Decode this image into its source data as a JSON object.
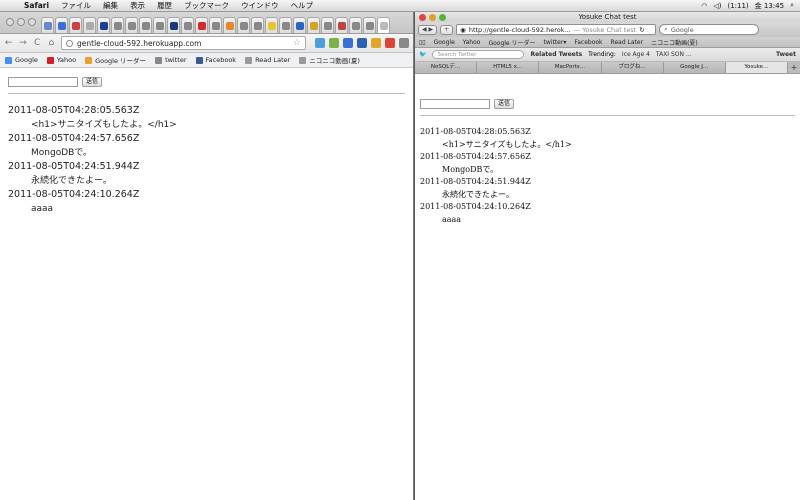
{
  "menubar": {
    "app": "Safari",
    "items": [
      "ファイル",
      "編集",
      "表示",
      "履歴",
      "ブックマーク",
      "ウインドウ",
      "ヘルプ"
    ],
    "battery": "(1:11)",
    "clock": "金 13:45"
  },
  "chrome": {
    "url": "gentle-cloud-592.herokuapp.com",
    "bookmarks": [
      "Google",
      "Yahoo",
      "Google リーダー",
      "twitter",
      "Facebook",
      "Read Later",
      "ニコニコ動画(夏)"
    ],
    "send_label": "送信"
  },
  "safari": {
    "title": "Yosuke Chat test",
    "url": "http://gentle-cloud-592.herok...",
    "url_suffix": "— Yosuke Chat test",
    "search_placeholder": "Google",
    "bookmarks": [
      "Google",
      "Yahoo",
      "Google リーダー",
      "twitter▾",
      "Facebook",
      "Read Later",
      "ニコニコ動画(夏)"
    ],
    "twitter": {
      "search_placeholder": "Search Twitter",
      "related": "Related Tweets",
      "trending_label": "Trending:",
      "trends": [
        "Ice Age 4",
        "TAXI SON ..."
      ],
      "tweet": "Tweet"
    },
    "tabs": [
      "NoSQLデ…",
      "HTML5 x…",
      "MacPorts…",
      "ブログね…",
      "Google J…",
      "Yosuke…"
    ],
    "send_label": "送信"
  },
  "messages": [
    {
      "time": "2011-08-05T04:28:05.563Z",
      "text": "<h1>サニタイズもしたよ。</h1>"
    },
    {
      "time": "2011-08-05T04:24:57.656Z",
      "text": "MongoDBで。"
    },
    {
      "time": "2011-08-05T04:24:51.944Z",
      "text": "永続化できたよー。"
    },
    {
      "time": "2011-08-05T04:24:10.264Z",
      "text": "aaaa"
    }
  ],
  "colors": {
    "accent_blue": "#3b6fd8",
    "close_red": "#e0443e",
    "minimize_yellow": "#dea123",
    "zoom_green": "#4fb63a"
  }
}
